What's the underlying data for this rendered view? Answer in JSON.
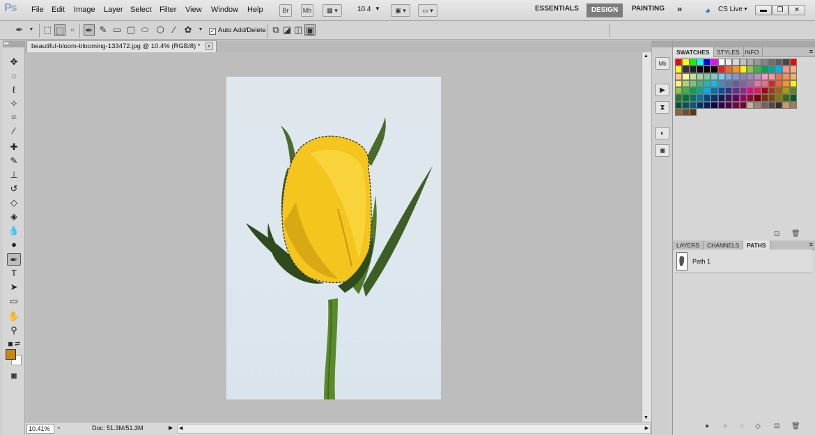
{
  "app": {
    "logo": "Ps",
    "menu": [
      "File",
      "Edit",
      "Image",
      "Layer",
      "Select",
      "Filter",
      "View",
      "Window",
      "Help"
    ],
    "bridge": "Br",
    "minibridge": "Mb",
    "zoom": "10.4",
    "workspaces": [
      "ESSENTIALS",
      "DESIGN",
      "PAINTING"
    ],
    "more": "»",
    "cslive": "CS Live"
  },
  "options": {
    "auto_add_label": "Auto Add/Delete",
    "auto_add_checked": "✓"
  },
  "document": {
    "tab_title": "beautiful-bloom-blooming-133472.jpg @ 10.4% (RGB/8) *",
    "close": "×"
  },
  "status": {
    "zoom": "10.41%",
    "doc_info": "Doc: 51.3M/51.3M"
  },
  "panels": {
    "top_tabs": [
      "SWATCHES",
      "STYLES",
      "INFO"
    ],
    "bottom_tabs": [
      "LAYERS",
      "CHANNELS",
      "PATHS"
    ],
    "path_name": "Path 1"
  },
  "colors": {
    "foreground": "#c8860f",
    "background": "#ffffff",
    "swatches": [
      "#ff0000",
      "#ffff00",
      "#00ff00",
      "#00ffff",
      "#0000ff",
      "#ff00ff",
      "#ffffff",
      "#ebebeb",
      "#d6d6d6",
      "#c2c2c2",
      "#adadad",
      "#999999",
      "#858585",
      "#707070",
      "#5c5c5c",
      "#474747",
      "#ff0000",
      "#ffff00",
      "#333333",
      "#1f1f1f",
      "#0a0a0a",
      "#000000",
      "#000000",
      "#ee1d24",
      "#f26522",
      "#f7941d",
      "#fff200",
      "#8dc63f",
      "#39b54a",
      "#00a651",
      "#00a99d",
      "#00aeef",
      "#f7977a",
      "#f9ad81",
      "#fdc68a",
      "#fff79a",
      "#c4df9b",
      "#a3d39c",
      "#82ca9d",
      "#7bcdc8",
      "#6ecff6",
      "#7ea7d8",
      "#8493ca",
      "#8882be",
      "#a187be",
      "#bc8dbf",
      "#f49ac2",
      "#f6989d",
      "#f26c4f",
      "#f68e55",
      "#fbaf5c",
      "#fff467",
      "#acd372",
      "#7cc576",
      "#3bb878",
      "#1abbb4",
      "#00bff3",
      "#438ccb",
      "#5574b9",
      "#605ca8",
      "#855fa8",
      "#a763a8",
      "#f06ea9",
      "#f26d7d",
      "#ed1c24",
      "#f26522",
      "#f7941d",
      "#fff200",
      "#8dc73f",
      "#39b54a",
      "#00a651",
      "#00a99d",
      "#00aeef",
      "#0072bc",
      "#0054a6",
      "#2e3192",
      "#662d91",
      "#92278f",
      "#ec008c",
      "#ed145b",
      "#9e0b0f",
      "#a0410d",
      "#a36209",
      "#aba000",
      "#598527",
      "#1a7b30",
      "#007236",
      "#00746b",
      "#0076a3",
      "#004b80",
      "#003471",
      "#1b1464",
      "#440e62",
      "#630460",
      "#9e005d",
      "#9e0039",
      "#790000",
      "#7b2e00",
      "#7d4900",
      "#827b00",
      "#406618",
      "#005e20",
      "#005826",
      "#005952",
      "#005b7f",
      "#003663",
      "#002157",
      "#0d004c",
      "#32004b",
      "#4b0049",
      "#7b0046",
      "#7a0026",
      "#c7b299",
      "#998675",
      "#736357",
      "#534741",
      "#37302d",
      "#c69c6d",
      "#a67c52",
      "#8c6239",
      "#754c24",
      "#603913"
    ]
  }
}
